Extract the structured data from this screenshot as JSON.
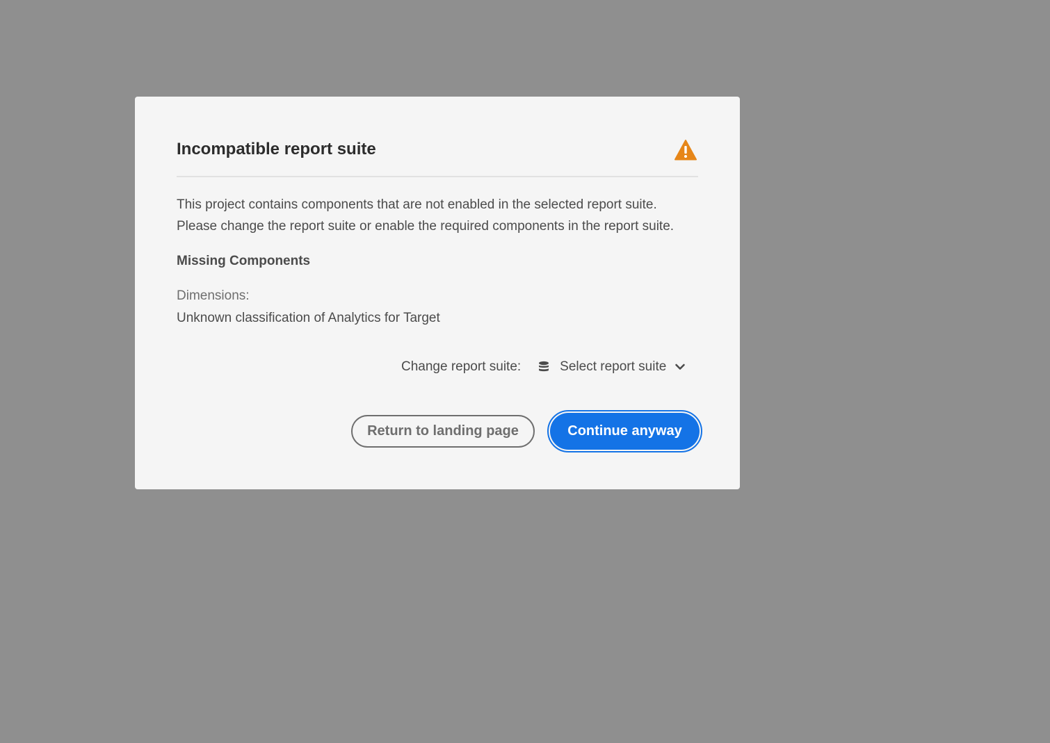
{
  "dialog": {
    "title": "Incompatible report suite",
    "alert_icon": "alert-triangle-icon",
    "alert_color": "#e68619",
    "description_lines": [
      "This project contains components that are not enabled in the selected report suite.",
      "Please change the report suite or enable the required components in the report suite."
    ],
    "missing_heading": "Missing Components",
    "dimensions_label": "Dimensions:",
    "dimensions": [
      "Unknown classification of Analytics for Target"
    ],
    "change_suite_label": "Change report suite:",
    "suite_picker": {
      "icon": "database-icon",
      "label": "Select report suite",
      "chevron": "chevron-down-icon"
    },
    "buttons": {
      "secondary_label": "Return to landing page",
      "primary_label": "Continue anyway"
    },
    "primary_color": "#1473e6"
  }
}
